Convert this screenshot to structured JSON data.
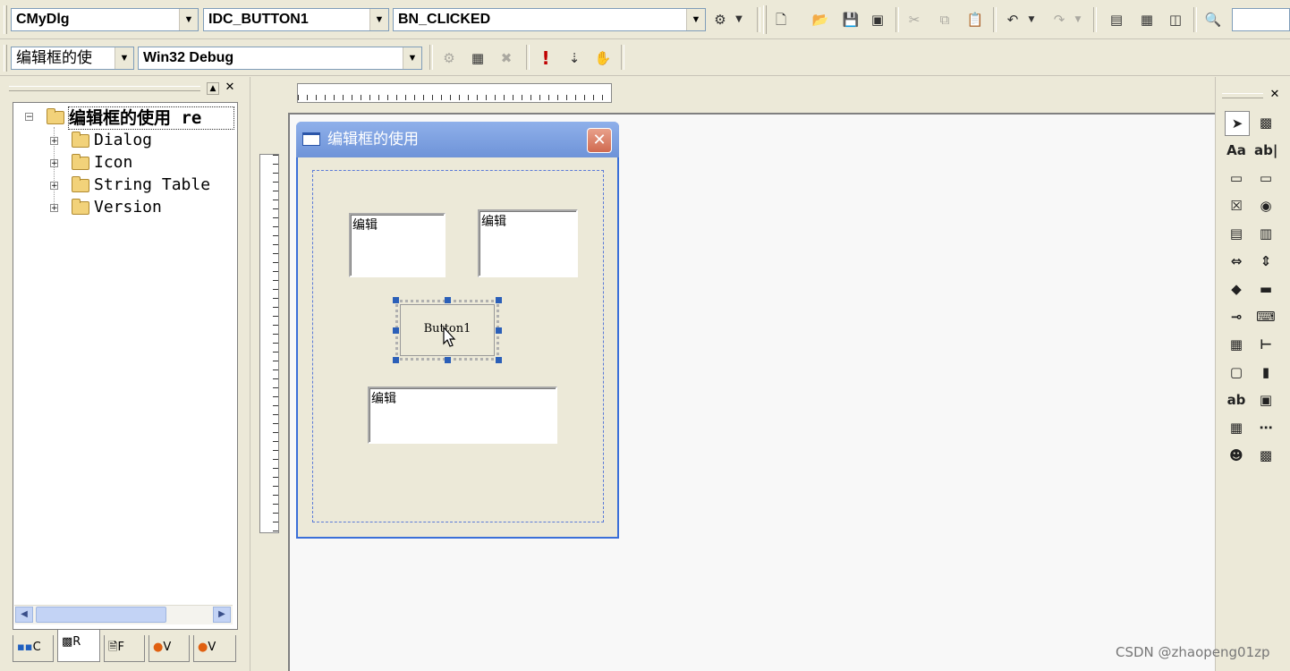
{
  "wizardbar": {
    "class_combo": "CMyDlg",
    "id_combo": "IDC_BUTTON1",
    "message_combo": "BN_CLICKED"
  },
  "build_toolbar": {
    "project_combo": "编辑框的使",
    "config_combo": "Win32 Debug"
  },
  "workspace": {
    "root_label": "编辑框的使用 re",
    "items": [
      {
        "label": "Dialog"
      },
      {
        "label": "Icon"
      },
      {
        "label": "String Table"
      },
      {
        "label": "Version"
      }
    ],
    "tabs": [
      {
        "label": "C"
      },
      {
        "label": "R"
      },
      {
        "label": "F"
      },
      {
        "label": "V"
      },
      {
        "label": "V"
      }
    ]
  },
  "dialog": {
    "title": "编辑框的使用",
    "edits": [
      {
        "text": "编辑"
      },
      {
        "text": "编辑"
      },
      {
        "text": "编辑"
      }
    ],
    "button_label": "Button1"
  },
  "controls_palette": {
    "icons": [
      "pointer-icon",
      "picture-icon",
      "static-text-icon",
      "edit-box-icon",
      "group-box-icon",
      "button-icon",
      "check-box-icon",
      "radio-button-icon",
      "combo-box-icon",
      "list-box-icon",
      "horizontal-scrollbar-icon",
      "vertical-scrollbar-icon",
      "spin-icon",
      "progress-icon",
      "slider-icon",
      "hotkey-icon",
      "list-control-icon",
      "tree-control-icon",
      "tab-control-icon",
      "animate-icon",
      "rich-edit-icon",
      "date-time-picker-icon",
      "month-calendar-icon",
      "ip-address-icon",
      "custom-control-icon",
      "extended-combo-icon"
    ]
  },
  "watermark": "CSDN @zhaopeng01zp"
}
